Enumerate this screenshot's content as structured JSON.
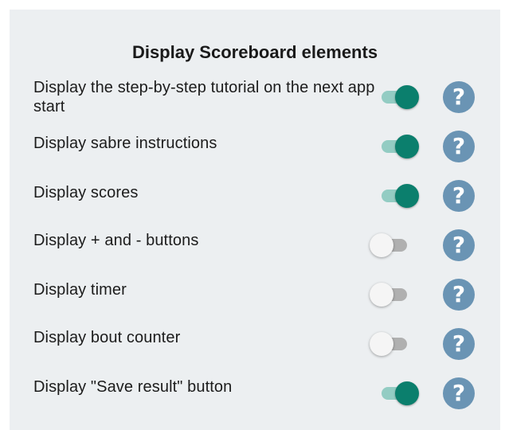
{
  "section": {
    "title": "Display Scoreboard elements"
  },
  "settings": [
    {
      "label": "Display the step-by-step tutorial on the next app start",
      "enabled": true,
      "help_glyph": "?"
    },
    {
      "label": "Display sabre instructions",
      "enabled": true,
      "help_glyph": "?"
    },
    {
      "label": "Display scores",
      "enabled": true,
      "help_glyph": "?"
    },
    {
      "label": "Display + and - buttons",
      "enabled": false,
      "help_glyph": "?"
    },
    {
      "label": "Display timer",
      "enabled": false,
      "help_glyph": "?"
    },
    {
      "label": "Display bout counter",
      "enabled": false,
      "help_glyph": "?"
    },
    {
      "label": "Display \"Save result\" button",
      "enabled": true,
      "help_glyph": "?"
    }
  ],
  "icons": {
    "help": "question-circle-icon"
  },
  "colors": {
    "panel_background": "#eceff1",
    "switch_on_thumb": "#0b7f6d",
    "switch_on_track": "#93ccc3",
    "switch_off_thumb": "#f5f5f5",
    "switch_off_track": "#b0b0b0",
    "help_button": "#6a94b4"
  }
}
